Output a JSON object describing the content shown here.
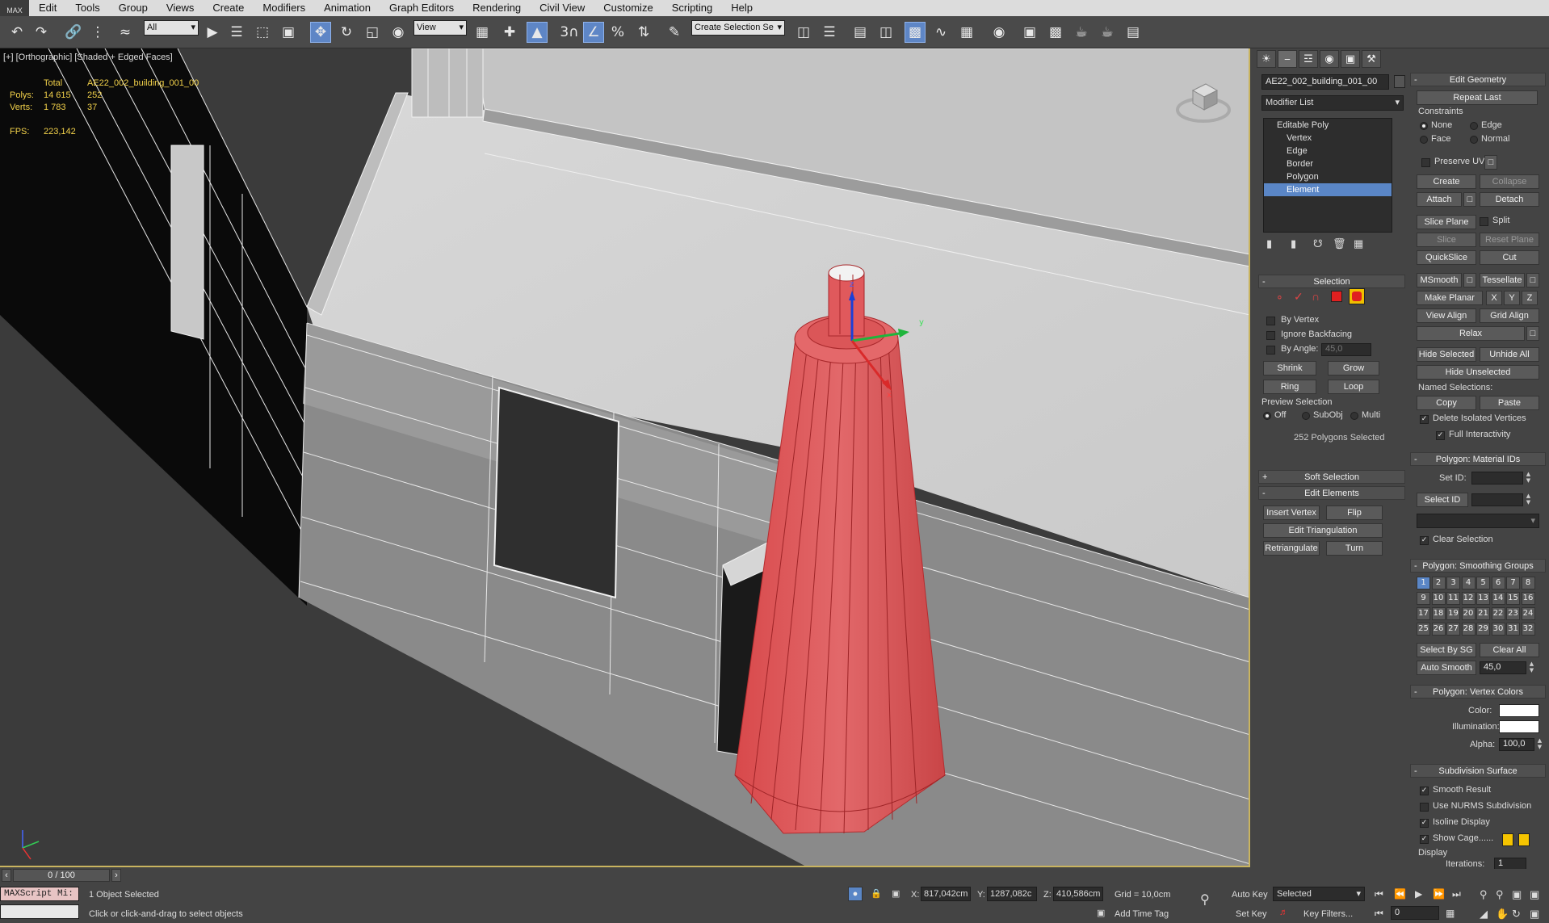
{
  "app": {
    "logo": "MAX"
  },
  "menu": [
    "Edit",
    "Tools",
    "Group",
    "Views",
    "Create",
    "Modifiers",
    "Animation",
    "Graph Editors",
    "Rendering",
    "Civil View",
    "Customize",
    "Scripting",
    "Help"
  ],
  "toolbar": {
    "filter_select": "All",
    "ref_coord_select": "View",
    "named_selection_select": "Create Selection Se",
    "snap_labels": {
      "snap": "3",
      "angle": "",
      "percent": "%"
    }
  },
  "viewport": {
    "label": "[+] [Orthographic] [Shaded + Edged Faces]",
    "stats": {
      "total_label": "Total",
      "object_name": "AE22_002_building_001_00",
      "polys_label": "Polys:",
      "polys_total": "14 615",
      "polys_selected": "252",
      "verts_label": "Verts:",
      "verts_total": "1 783",
      "verts_selected": "37",
      "fps_label": "FPS:",
      "fps_value": "223,142"
    },
    "gizmo_axes": {
      "x": "x",
      "y": "y",
      "z": "z"
    }
  },
  "command_panel": {
    "object_name": "AE22_002_building_001_00",
    "modifier_list": "Modifier List",
    "stack": {
      "top": "Editable Poly",
      "items": [
        "Vertex",
        "Edge",
        "Border",
        "Polygon",
        "Element"
      ],
      "selected": "Element"
    },
    "selection": {
      "title": "Selection",
      "by_vertex": "By Vertex",
      "ignore_backfacing": "Ignore Backfacing",
      "by_angle": "By Angle:",
      "angle_value": "45,0",
      "shrink": "Shrink",
      "grow": "Grow",
      "ring": "Ring",
      "loop": "Loop",
      "preview_title": "Preview Selection",
      "preview_off": "Off",
      "preview_subobj": "SubObj",
      "preview_multi": "Multi",
      "status": "252 Polygons Selected"
    },
    "soft_selection": {
      "title": "Soft Selection"
    },
    "edit_elements": {
      "title": "Edit Elements",
      "insert_vertex": "Insert Vertex",
      "flip": "Flip",
      "edit_triangulation": "Edit Triangulation",
      "retriangulate": "Retriangulate",
      "turn": "Turn"
    },
    "edit_geometry": {
      "title": "Edit Geometry",
      "repeat_last": "Repeat Last",
      "constraints": "Constraints",
      "none": "None",
      "edge": "Edge",
      "face": "Face",
      "normal": "Normal",
      "preserve_uvs": "Preserve UVs",
      "create": "Create",
      "collapse": "Collapse",
      "attach": "Attach",
      "detach": "Detach",
      "slice_plane": "Slice Plane",
      "split": "Split",
      "slice": "Slice",
      "reset_plane": "Reset Plane",
      "quickslice": "QuickSlice",
      "cut": "Cut",
      "msmooth": "MSmooth",
      "tessellate": "Tessellate",
      "make_planar": "Make Planar",
      "x": "X",
      "y": "Y",
      "z": "Z",
      "view_align": "View Align",
      "grid_align": "Grid Align",
      "relax": "Relax",
      "hide_selected": "Hide Selected",
      "unhide_all": "Unhide All",
      "hide_unselected": "Hide Unselected",
      "named_selections": "Named Selections:",
      "copy": "Copy",
      "paste": "Paste",
      "delete_isolated": "Delete Isolated Vertices",
      "full_interactivity": "Full Interactivity"
    },
    "material_ids": {
      "title": "Polygon: Material IDs",
      "set_id": "Set ID:",
      "select_id": "Select ID",
      "clear_selection": "Clear Selection"
    },
    "smoothing_groups": {
      "title": "Polygon: Smoothing Groups",
      "groups": [
        "1",
        "2",
        "3",
        "4",
        "5",
        "6",
        "7",
        "8",
        "9",
        "10",
        "11",
        "12",
        "13",
        "14",
        "15",
        "16",
        "17",
        "18",
        "19",
        "20",
        "21",
        "22",
        "23",
        "24",
        "25",
        "26",
        "27",
        "28",
        "29",
        "30",
        "31",
        "32"
      ],
      "active": "1",
      "select_by_sg": "Select By SG",
      "clear_all": "Clear All",
      "auto_smooth": "Auto Smooth",
      "auto_smooth_value": "45,0"
    },
    "vertex_colors": {
      "title": "Polygon: Vertex Colors",
      "color": "Color:",
      "illumination": "Illumination:",
      "alpha": "Alpha:",
      "alpha_value": "100,0",
      "color_hex": "#ffffff"
    },
    "subdivision": {
      "title": "Subdivision Surface",
      "smooth_result": "Smooth Result",
      "use_nurms": "Use NURMS Subdivision",
      "isoline_display": "Isoline Display",
      "show_cage": "Show Cage......",
      "display": "Display",
      "iterations": "Iterations:",
      "iterations_value": "1",
      "cage_colors": [
        "#f5c400",
        "#f5c400"
      ]
    }
  },
  "timeline": {
    "frame": "0 / 100"
  },
  "statusbar": {
    "maxscript": "MAXScript Mi:",
    "objects_selected": "1 Object Selected",
    "prompt": "Click or click-and-drag to select objects",
    "x_label": "X:",
    "x_value": "817,042cm",
    "y_label": "Y:",
    "y_value": "1287,082c",
    "z_label": "Z:",
    "z_value": "410,586cm",
    "grid": "Grid = 10,0cm",
    "add_time_tag": "Add Time Tag",
    "auto_key": "Auto Key",
    "set_key": "Set Key",
    "key_mode": "Selected",
    "key_filters": "Key Filters...",
    "frame_value": "0"
  },
  "colors": {
    "selection_red": "#d9474a",
    "active_blue": "#5a86c6",
    "viewport_border": "#c9b45f"
  }
}
